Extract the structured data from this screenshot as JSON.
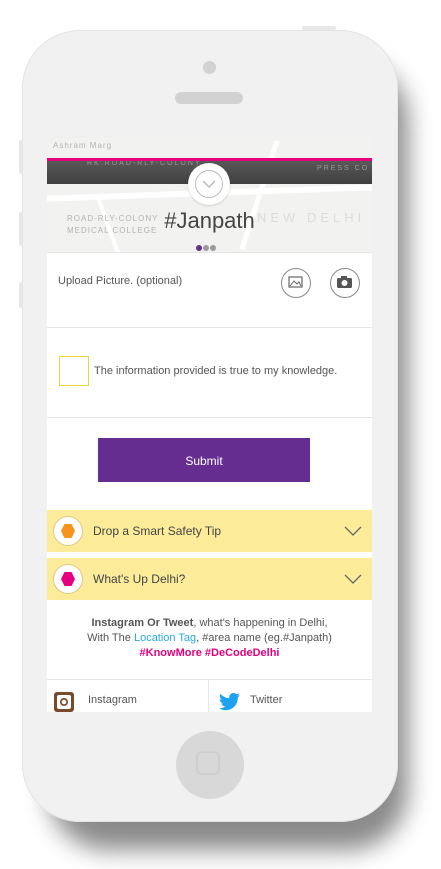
{
  "header": {
    "title": "#Janpath",
    "map_labels": [
      "Ashram Marg",
      "RK ROAD-RLY-COLONY",
      "PRESS CO",
      "NEW DELHI",
      "ROAD-RLY-COLONY",
      "MEDICAL COLLEGE"
    ],
    "dots_colors": [
      "#662d91",
      "#9a9a9a",
      "#9a9a9a"
    ]
  },
  "upload": {
    "label": "Upload Picture. (optional)",
    "icons": [
      "image-icon",
      "camera-icon"
    ]
  },
  "consent": {
    "label": "The information provided is true to my knowledge."
  },
  "submit": {
    "label": "Submit"
  },
  "accordions": [
    {
      "label": "Drop a Smart Safety Tip",
      "hex_color": "#f7941d"
    },
    {
      "label": "What's Up Delhi?",
      "hex_color": "#e6007e"
    }
  ],
  "info": {
    "bold_prefix": "Instagram Or Tweet",
    "line1_rest": ", what's  happening in Delhi,",
    "line2_prefix": "With The ",
    "location_tag": "Location Tag",
    "line2_suffix": ", #area name (eg.#Janpath)",
    "hashtags": "#KnowMore #DeCodeDelhi"
  },
  "social": {
    "instagram": "Instagram",
    "twitter": "Twitter"
  },
  "colors": {
    "accent_purple": "#662d91",
    "accent_pink": "#e6007e",
    "accordion_bg": "#fcec9a",
    "checkbox_border": "#f0d23a",
    "link_blue": "#29a9e0",
    "twitter_blue": "#1da1f2"
  }
}
